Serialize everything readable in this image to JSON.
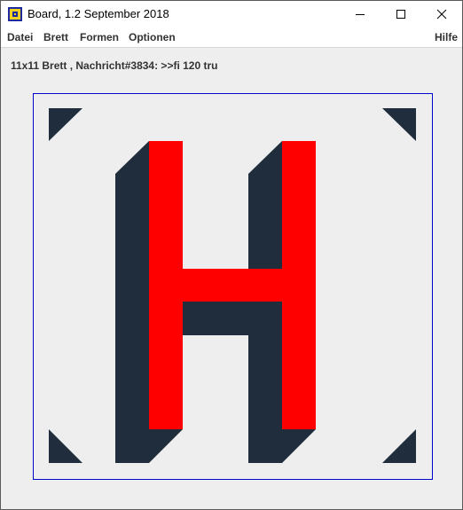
{
  "window": {
    "title": "Board, 1.2 September 2018"
  },
  "menu": {
    "items": [
      "Datei",
      "Brett",
      "Formen",
      "Optionen"
    ],
    "help": "Hilfe"
  },
  "status": {
    "text": "11x11 Brett , Nachricht#3834: >>fi 120 tru"
  },
  "board": {
    "size": "11x11",
    "glyph": "H",
    "colors": {
      "letter": "#ff0000",
      "shadow": "#1f2d3d",
      "border": "#0000cc",
      "background": "#eeeeee"
    }
  }
}
